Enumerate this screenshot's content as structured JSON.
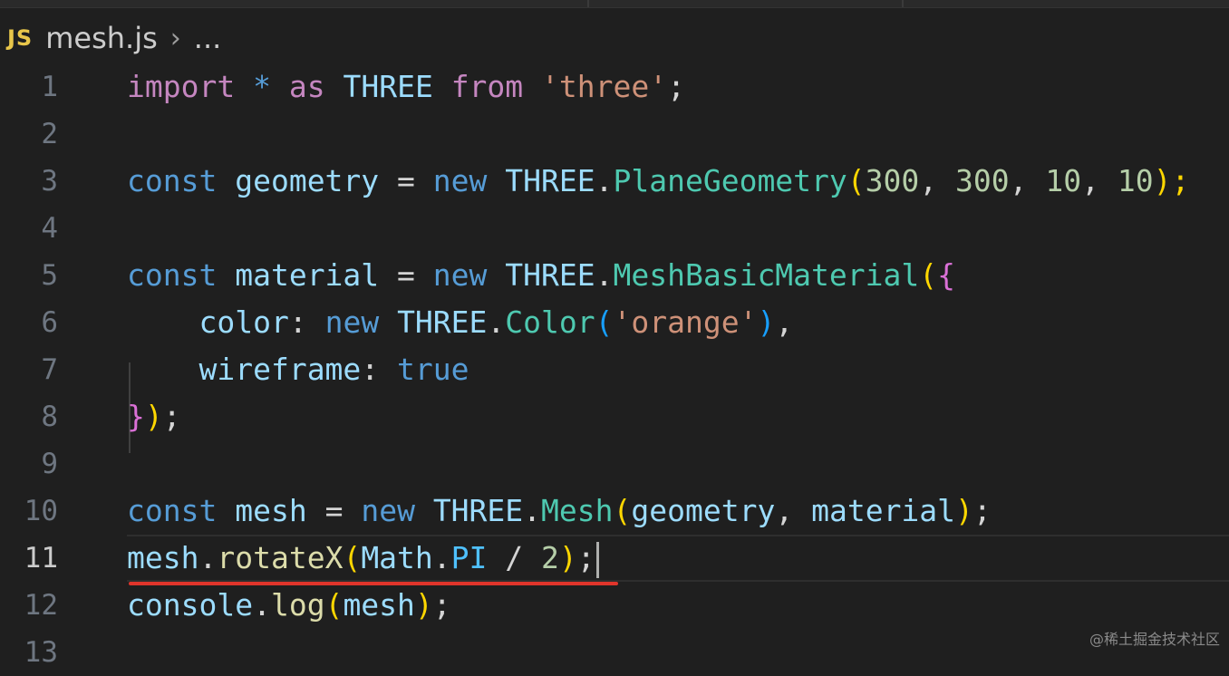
{
  "breadcrumb": {
    "file_icon": "JS",
    "file_name": "mesh.js",
    "separator_icon": "chevron-right-icon",
    "ellipsis": "..."
  },
  "editor": {
    "active_line": 11,
    "lines": [
      {
        "number": "1"
      },
      {
        "number": "2"
      },
      {
        "number": "3"
      },
      {
        "number": "4"
      },
      {
        "number": "5"
      },
      {
        "number": "6"
      },
      {
        "number": "7"
      },
      {
        "number": "8"
      },
      {
        "number": "9"
      },
      {
        "number": "10"
      },
      {
        "number": "11"
      },
      {
        "number": "12"
      },
      {
        "number": "13"
      }
    ],
    "tokens": {
      "l1": [
        "import",
        " ",
        "*",
        " ",
        "as",
        " ",
        "THREE",
        " ",
        "from",
        " ",
        "'three'",
        ";"
      ],
      "l3": [
        "const",
        " ",
        "geometry",
        " ",
        "=",
        " ",
        "new",
        " ",
        "THREE",
        ".",
        "PlaneGeometry",
        "(",
        "300",
        ", ",
        "300",
        ", ",
        "10",
        ", ",
        "10",
        ");"
      ],
      "l5": [
        "const",
        " ",
        "material",
        " ",
        "=",
        " ",
        "new",
        " ",
        "THREE",
        ".",
        "MeshBasicMaterial",
        "(",
        "{"
      ],
      "l6": [
        "    ",
        "color",
        ": ",
        "new",
        " ",
        "THREE",
        ".",
        "Color",
        "(",
        "'orange'",
        ")",
        ","
      ],
      "l7": [
        "    ",
        "wireframe",
        ": ",
        "true"
      ],
      "l8": [
        "}",
        ")",
        ";"
      ],
      "l10": [
        "const",
        " ",
        "mesh",
        " ",
        "=",
        " ",
        "new",
        " ",
        "THREE",
        ".",
        "Mesh",
        "(",
        "geometry",
        ", ",
        "material",
        ")",
        ";"
      ],
      "l11": [
        "mesh",
        ".",
        "rotateX",
        "(",
        "Math",
        ".",
        "PI",
        " / ",
        "2",
        ")",
        ";"
      ],
      "l12": [
        "console",
        ".",
        "log",
        "(",
        "mesh",
        ")",
        ";"
      ]
    }
  },
  "annotation": {
    "underline_color": "#e0352b",
    "underlined_line": 11
  },
  "watermark": "@稀土掘金技术社区"
}
